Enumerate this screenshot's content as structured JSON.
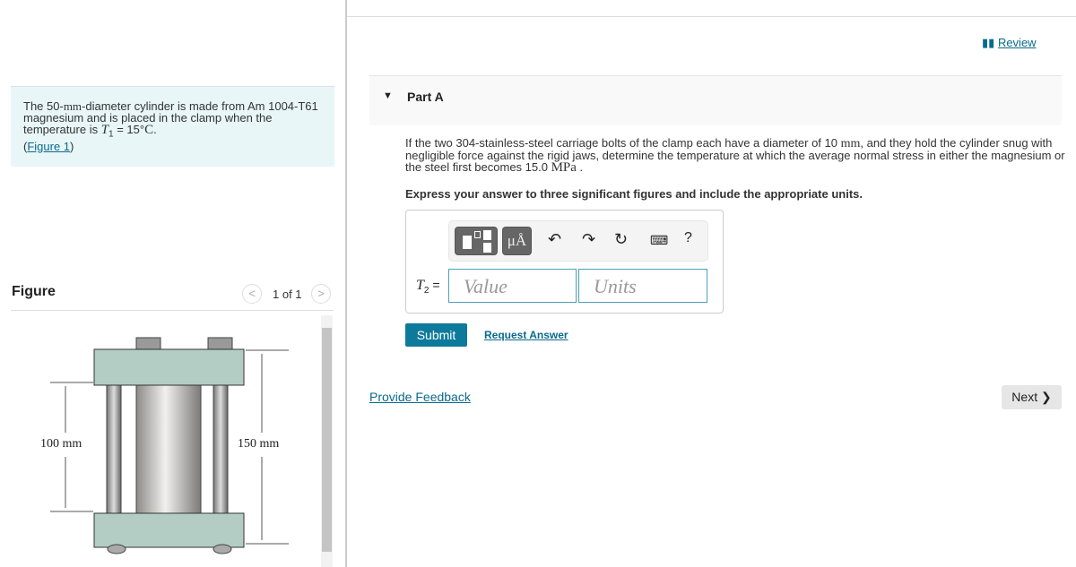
{
  "problem": {
    "text_pre": "The 50-",
    "unit_mm": "mm",
    "text_mid": "-diameter cylinder is made from Am 1004-T61 magnesium and is placed in the clamp when the temperature is ",
    "var": "T",
    "sub": "1",
    "eq": " = 15°",
    "unit_c": "C",
    "end": ".",
    "fig_open": "(",
    "fig_link": "Figure 1",
    "fig_close": ")"
  },
  "figure": {
    "title": "Figure",
    "page": "1 of 1",
    "dim_left": "100 mm",
    "dim_right": "150 mm"
  },
  "header": {
    "review": "Review"
  },
  "part": {
    "label": "Part A"
  },
  "question": {
    "pre": "If the two 304-stainless-steel carriage bolts of the clamp each have a diameter of 10 ",
    "mm": "mm",
    "mid": ", and they hold the cylinder snug with negligible force against the rigid jaws, determine the temperature at which the average normal stress in either the magnesium or the steel first becomes 15.0 ",
    "mpa": "MPa",
    "end": " ."
  },
  "instructions": "Express your answer to three significant figures and include the appropriate units.",
  "answer": {
    "var": "T",
    "sub": "2",
    "eq": "=",
    "value_placeholder": "Value",
    "units_placeholder": "Units",
    "units_btn": "μÅ",
    "help": "?"
  },
  "buttons": {
    "submit": "Submit",
    "request": "Request Answer",
    "feedback": "Provide Feedback",
    "next": "Next ❯"
  },
  "colors": {
    "accent": "#0d7a9b",
    "problem_bg": "#e8f6f8",
    "plate": "#b3cdc4"
  }
}
